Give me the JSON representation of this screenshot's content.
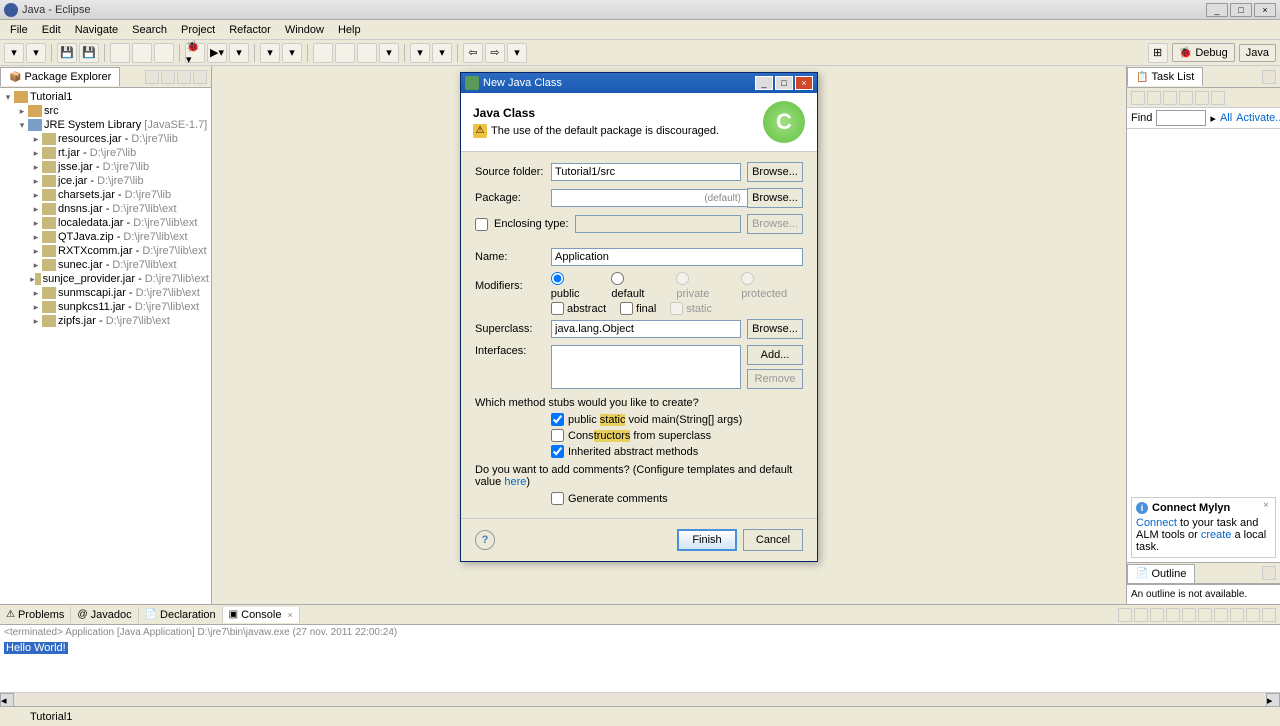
{
  "window": {
    "title": "Java - Eclipse"
  },
  "menu": [
    "File",
    "Edit",
    "Navigate",
    "Search",
    "Project",
    "Refactor",
    "Window",
    "Help"
  ],
  "perspective": {
    "debug": "Debug",
    "java": "Java"
  },
  "packageExplorer": {
    "title": "Package Explorer",
    "project": "Tutorial1",
    "src": "src",
    "library": "JRE System Library",
    "libraryVersion": "[JavaSE-1.7]",
    "jars": [
      {
        "name": "resources.jar",
        "path": "D:\\jre7\\lib"
      },
      {
        "name": "rt.jar",
        "path": "D:\\jre7\\lib"
      },
      {
        "name": "jsse.jar",
        "path": "D:\\jre7\\lib"
      },
      {
        "name": "jce.jar",
        "path": "D:\\jre7\\lib"
      },
      {
        "name": "charsets.jar",
        "path": "D:\\jre7\\lib"
      },
      {
        "name": "dnsns.jar",
        "path": "D:\\jre7\\lib\\ext"
      },
      {
        "name": "localedata.jar",
        "path": "D:\\jre7\\lib\\ext"
      },
      {
        "name": "QTJava.zip",
        "path": "D:\\jre7\\lib\\ext"
      },
      {
        "name": "RXTXcomm.jar",
        "path": "D:\\jre7\\lib\\ext"
      },
      {
        "name": "sunec.jar",
        "path": "D:\\jre7\\lib\\ext"
      },
      {
        "name": "sunjce_provider.jar",
        "path": "D:\\jre7\\lib\\ext"
      },
      {
        "name": "sunmscapi.jar",
        "path": "D:\\jre7\\lib\\ext"
      },
      {
        "name": "sunpkcs11.jar",
        "path": "D:\\jre7\\lib\\ext"
      },
      {
        "name": "zipfs.jar",
        "path": "D:\\jre7\\lib\\ext"
      }
    ]
  },
  "taskList": {
    "title": "Task List",
    "find": "Find",
    "all": "All",
    "activate": "Activate..."
  },
  "mylyn": {
    "title": "Connect Mylyn",
    "text1": "Connect",
    "text2": " to your task and ALM tools or ",
    "text3": "create",
    "text4": " a local task."
  },
  "outline": {
    "title": "Outline",
    "empty": "An outline is not available."
  },
  "bottomTabs": {
    "problems": "Problems",
    "javadoc": "Javadoc",
    "declaration": "Declaration",
    "console": "Console"
  },
  "console": {
    "header": "<terminated> Application [Java Application] D:\\jre7\\bin\\javaw.exe (27 nov. 2011 22:00:24)",
    "output": "Hello World!"
  },
  "statusbar": {
    "text": "Tutorial1"
  },
  "dialog": {
    "title": "New Java Class",
    "headerTitle": "Java Class",
    "warning": "The use of the default package is discouraged.",
    "sourceFolder": {
      "label": "Source folder:",
      "value": "Tutorial1/src",
      "browse": "Browse..."
    },
    "package": {
      "label": "Package:",
      "value": "",
      "default": "(default)",
      "browse": "Browse..."
    },
    "enclosing": {
      "label": "Enclosing type:",
      "value": "",
      "browse": "Browse..."
    },
    "name": {
      "label": "Name:",
      "value": "Application"
    },
    "modifiers": {
      "label": "Modifiers:",
      "public": "public",
      "default": "default",
      "private": "private",
      "protected": "protected",
      "abstract": "abstract",
      "final": "final",
      "static": "static"
    },
    "superclass": {
      "label": "Superclass:",
      "value": "java.lang.Object",
      "browse": "Browse..."
    },
    "interfaces": {
      "label": "Interfaces:",
      "add": "Add...",
      "remove": "Remove"
    },
    "stubs": {
      "question": "Which method stubs would you like to create?",
      "main": "public static void main(String[] args)",
      "constructors": "Constructors from superclass",
      "inherited": "Inherited abstract methods"
    },
    "comments": {
      "question1": "Do you want to add comments? (Configure templates and default value ",
      "here": "here",
      "question2": ")",
      "generate": "Generate comments"
    },
    "finish": "Finish",
    "cancel": "Cancel"
  }
}
